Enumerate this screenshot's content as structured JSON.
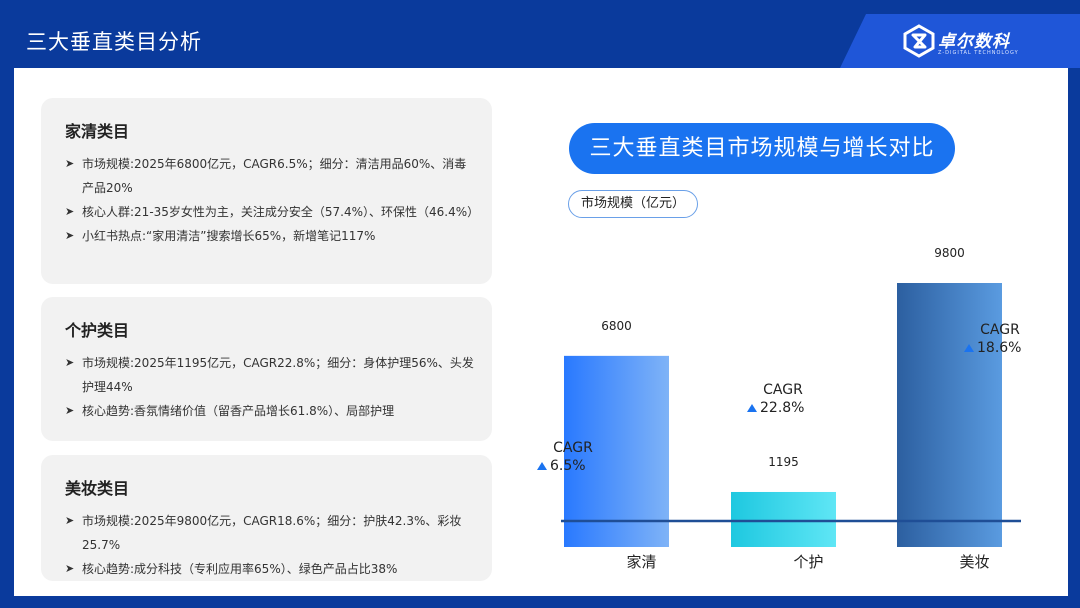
{
  "header": {
    "title": "三大垂直类目分析"
  },
  "brand": {
    "name": "卓尔数科",
    "subtitle": "Z-DIGITAL TECHNOLOGY"
  },
  "cards": [
    {
      "title": "家清类目",
      "items": [
        "市场规模:2025年6800亿元，CAGR6.5%；细分：清洁用品60%、消毒产品20%",
        "核心人群:21-35岁女性为主，关注成分安全（57.4%）、环保性（46.4%）",
        "小红书热点:“家用清洁”搜索增长65%，新增笔记117%"
      ]
    },
    {
      "title": "个护类目",
      "items": [
        "市场规模:2025年1195亿元，CAGR22.8%；细分：身体护理56%、头发护理44%",
        "核心趋势:香氛情绪价值（留香产品增长61.8%）、局部护理"
      ]
    },
    {
      "title": "美妆类目",
      "items": [
        "市场规模:2025年9800亿元，CAGR18.6%；细分：护肤42.3%、彩妆25.7%",
        "核心趋势:成分科技（专利应用率65%）、绿色产品占比38%"
      ]
    }
  ],
  "chart_data": {
    "type": "bar",
    "title": "三大垂直类目市场规模与增长对比",
    "ylabel": "市场规模（亿元）",
    "categories": [
      "家清",
      "个护",
      "美妆"
    ],
    "values": [
      6800,
      1195,
      9800
    ],
    "value_labels": [
      "6800",
      "1195",
      "9800"
    ],
    "cagr_label": "CAGR",
    "cagr": [
      "6.5%",
      "22.8%",
      "18.6%"
    ],
    "ylim": [
      0,
      10000
    ],
    "grid": false,
    "colors": [
      [
        "#2979ff",
        "#7fb3f7"
      ],
      [
        "#1ec8e0",
        "#5fe6f5"
      ],
      [
        "#2c5fa0",
        "#5a9be0"
      ]
    ],
    "baseline_color": "#1f4e96",
    "cagr_color": "#1a73f0"
  }
}
